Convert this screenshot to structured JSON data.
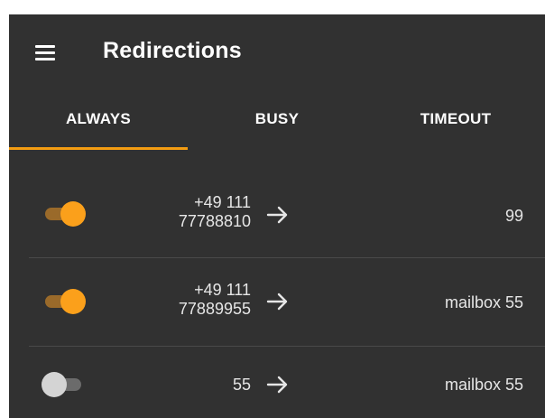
{
  "app_bar": {
    "title": "Redirections",
    "menu_icon": "hamburger-menu-icon"
  },
  "tabs": [
    {
      "label": "ALWAYS",
      "selected": true
    },
    {
      "label": "BUSY",
      "selected": false
    },
    {
      "label": "TIMEOUT",
      "selected": false
    }
  ],
  "redirections": [
    {
      "enabled": true,
      "source_line1": "+49 111",
      "source_line2": "77788810",
      "target": "99"
    },
    {
      "enabled": true,
      "source_line1": "+49 111",
      "source_line2": "77889955",
      "target": "mailbox 55"
    },
    {
      "enabled": false,
      "source_line1": "55",
      "source_line2": "",
      "target": "mailbox 55"
    }
  ],
  "colors": {
    "background": "#313131",
    "accent": "#fba01b",
    "text": "#ffffff"
  }
}
